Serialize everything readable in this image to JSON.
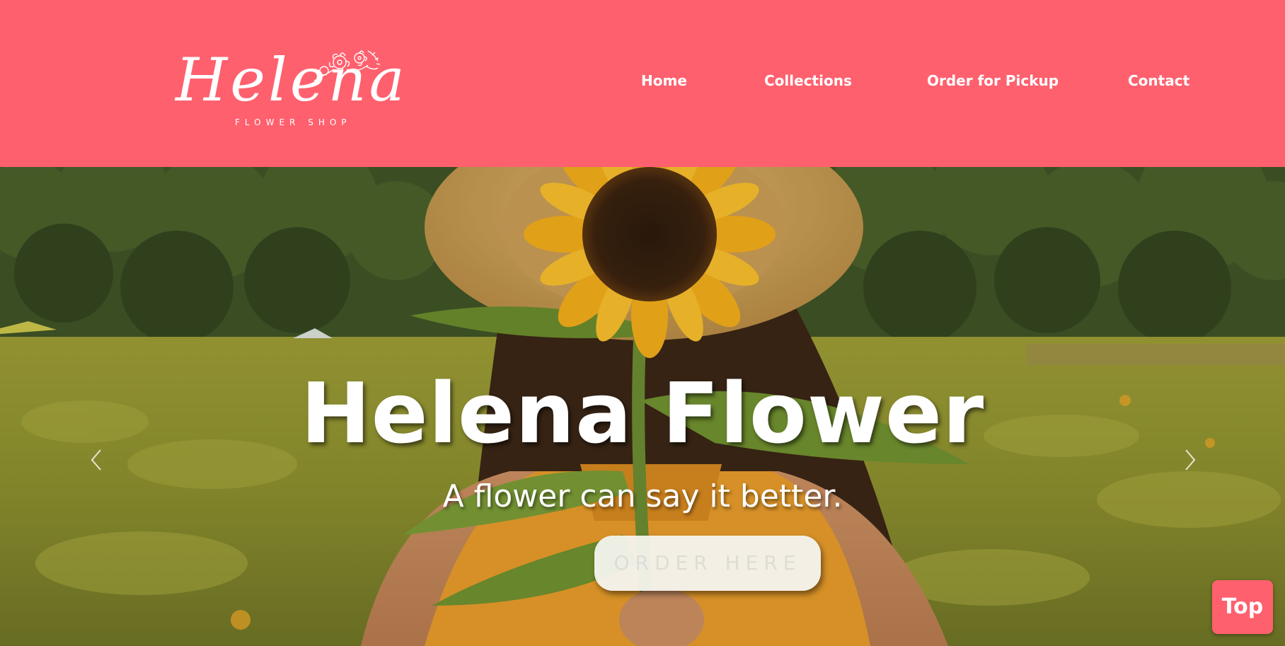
{
  "header": {
    "logo": {
      "script": "Helena",
      "subtitle": "FLOWER SHOP"
    },
    "nav": [
      {
        "label": "Home"
      },
      {
        "label": "Collections"
      },
      {
        "label": "Order for Pickup"
      },
      {
        "label": "Contact"
      }
    ]
  },
  "hero": {
    "title": "Helena Flower",
    "subtitle": "A flower can say it better.",
    "button_label": "ORDER HERE",
    "prev_icon": "chevron-left-icon",
    "next_icon": "chevron-right-icon"
  },
  "top_button": {
    "label": "Top"
  },
  "colors": {
    "brand": "#ff606e",
    "nav_text": "#ffffff",
    "button_bg": "#f5f4f0",
    "button_text": "#dedcd6"
  }
}
